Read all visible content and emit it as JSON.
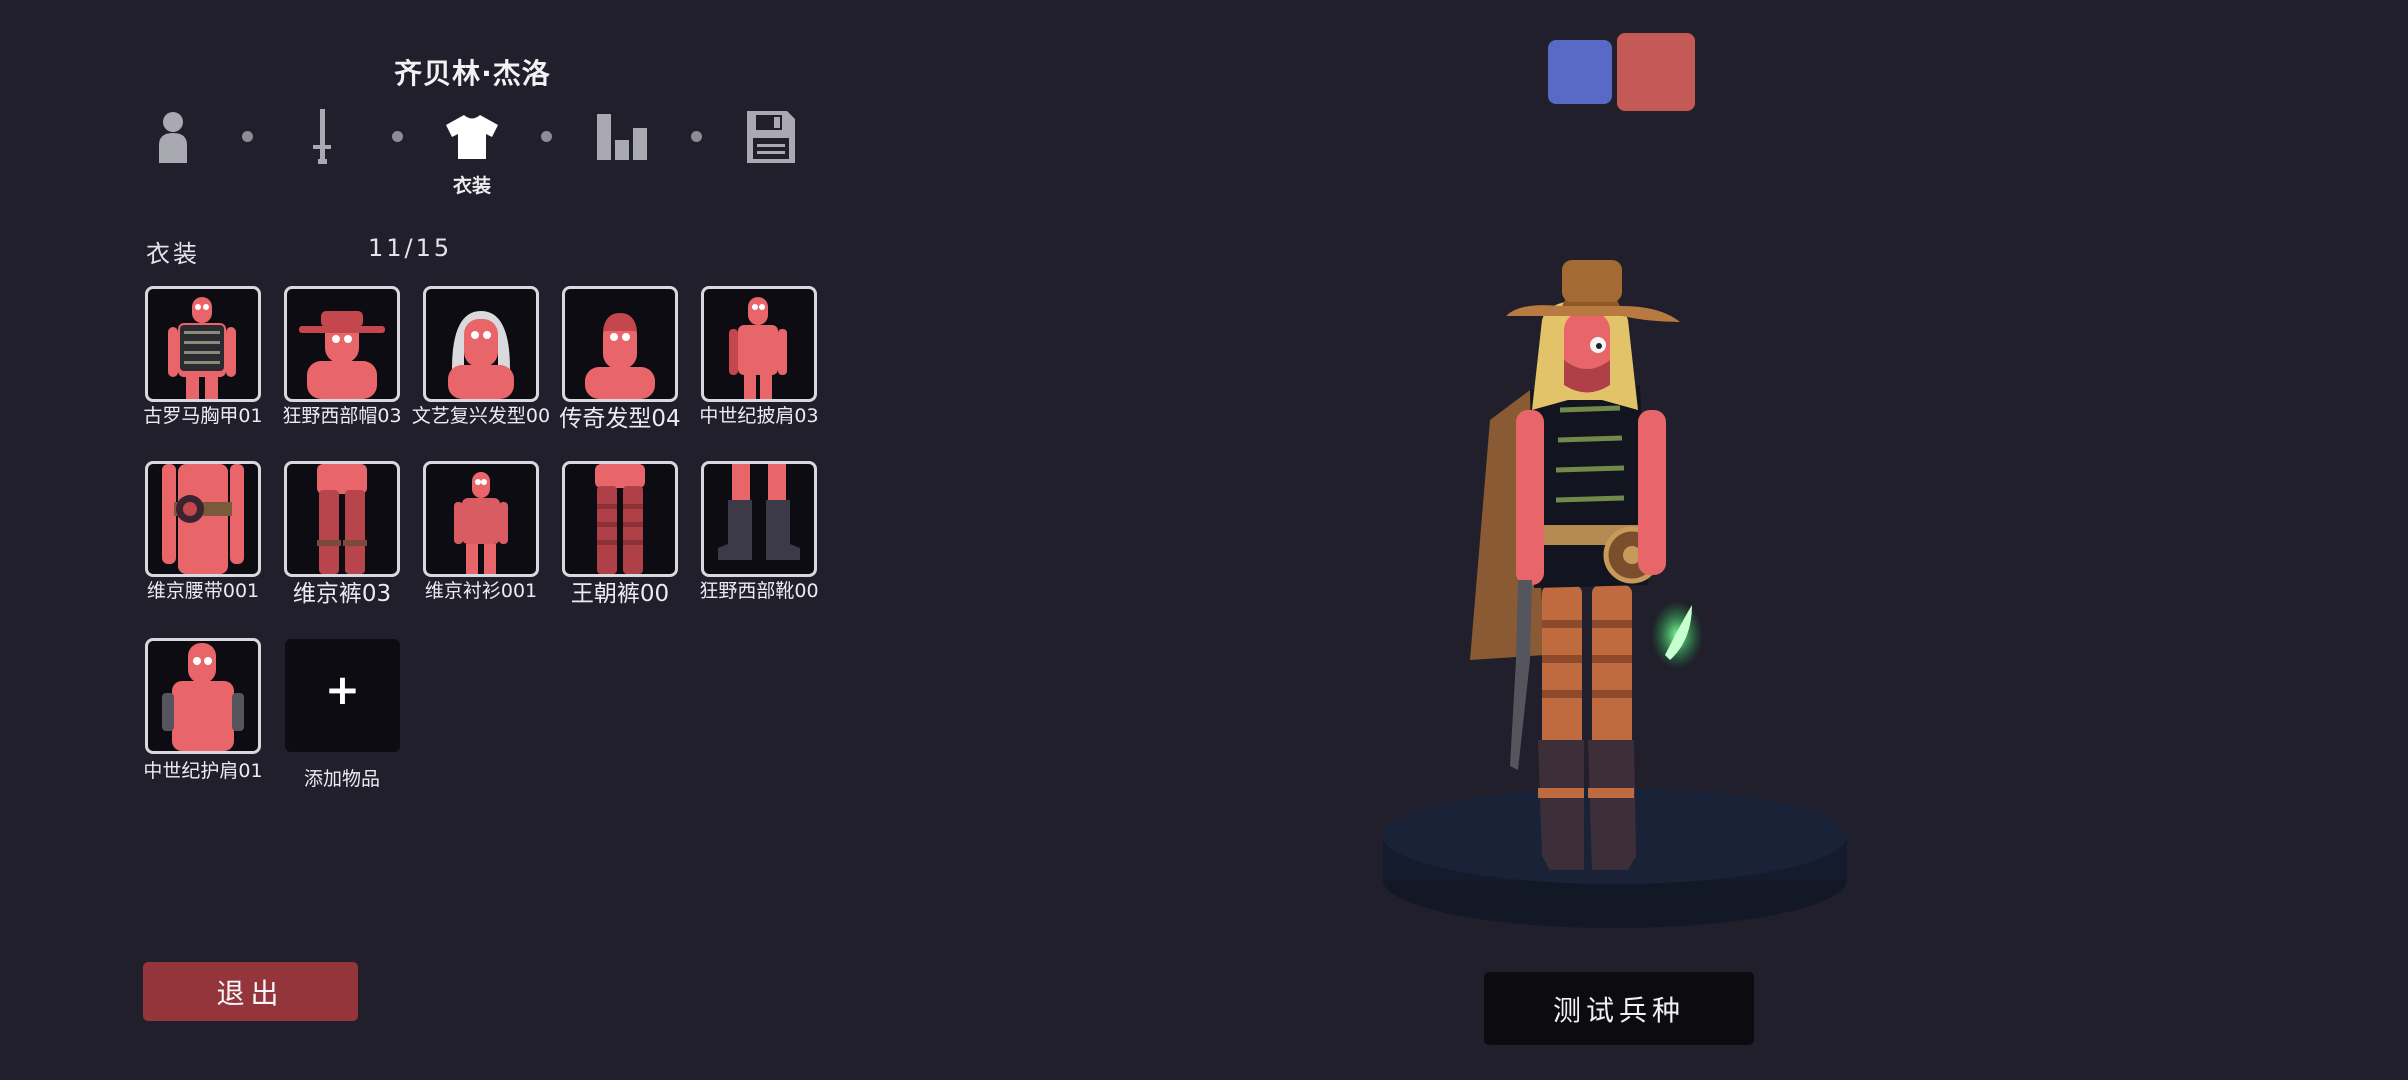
{
  "unit": {
    "name": "齐贝林·杰洛"
  },
  "steps": [
    {
      "name": "body-icon"
    },
    {
      "name": "weapon-icon"
    },
    {
      "name": "clothing-icon",
      "label": "衣装",
      "active": true
    },
    {
      "name": "stats-icon"
    },
    {
      "name": "save-icon"
    }
  ],
  "section": {
    "label": "衣装",
    "count": "11/15"
  },
  "items": [
    {
      "label": "古罗马胸甲01"
    },
    {
      "label": "狂野西部帽03"
    },
    {
      "label": "文艺复兴发型00"
    },
    {
      "label": "传奇发型04"
    },
    {
      "label": "中世纪披肩03"
    },
    {
      "label": "维京腰带001"
    },
    {
      "label": "维京裤03"
    },
    {
      "label": "维京衬衫001"
    },
    {
      "label": "王朝裤00"
    },
    {
      "label": "狂野西部靴00"
    },
    {
      "label": "中世纪护肩01"
    }
  ],
  "add_item": {
    "symbol": "+",
    "label": "添加物品"
  },
  "buttons": {
    "exit": "退出",
    "test": "测试兵种"
  },
  "teams": [
    {
      "name": "blue",
      "color": "#5869c6"
    },
    {
      "name": "red",
      "color": "#c45a55",
      "selected": true
    }
  ],
  "colors": {
    "background": "#201f2b",
    "unit_skin": "#e8656a",
    "exit_button": "#93353b",
    "tile_border": "#d8d8de"
  }
}
